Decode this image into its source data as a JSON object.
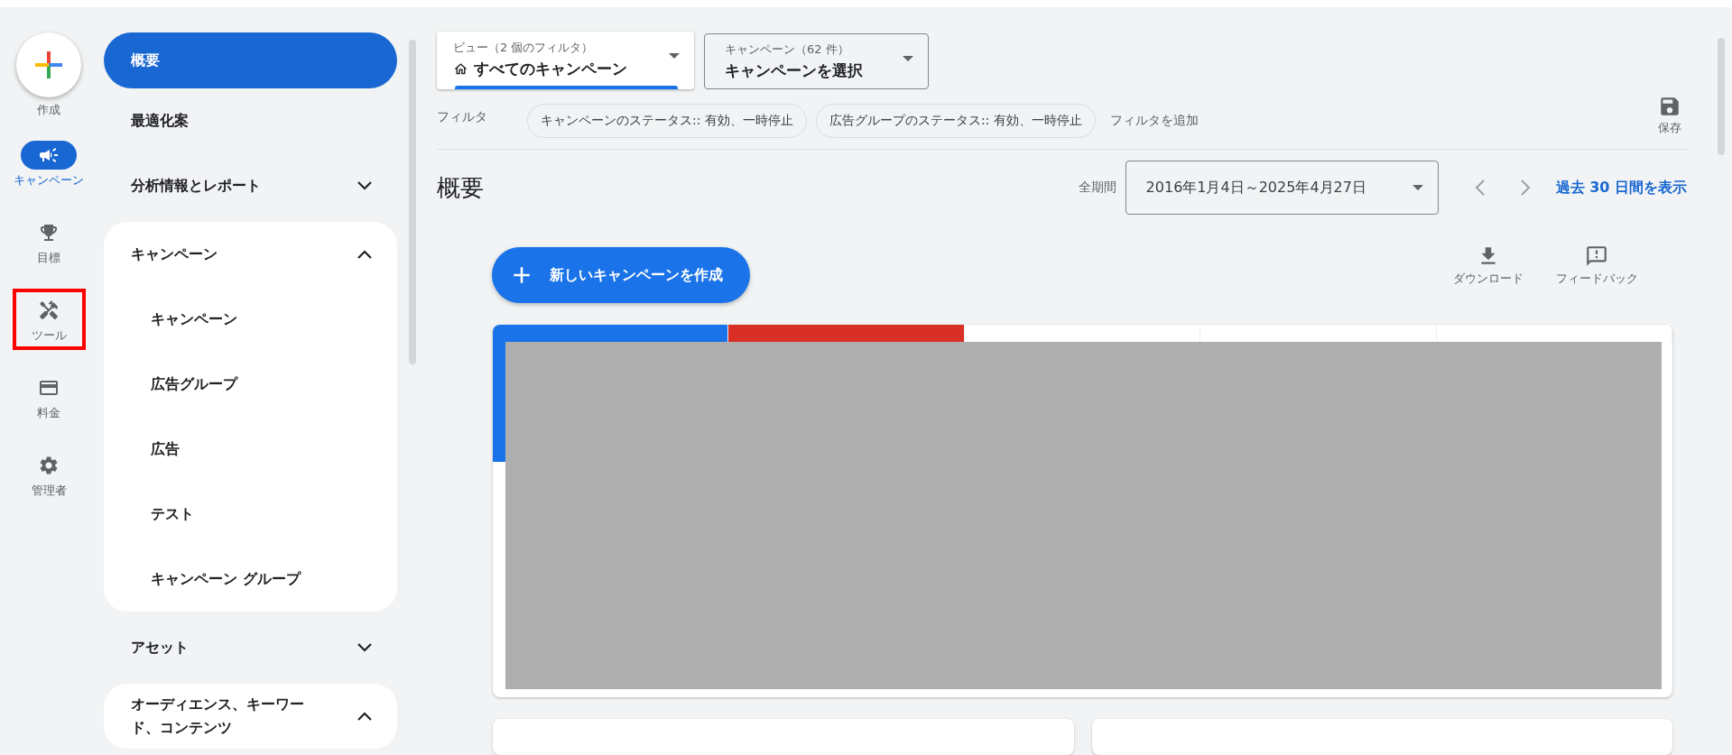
{
  "rail": {
    "create": {
      "label": "作成"
    },
    "items": [
      {
        "kind": "campaign",
        "label": "キャンペーン",
        "selected": true,
        "highlighted": false
      },
      {
        "kind": "goals",
        "label": "目標",
        "selected": false,
        "highlighted": false
      },
      {
        "kind": "tools",
        "label": "ツール",
        "selected": false,
        "highlighted": true
      },
      {
        "kind": "billing",
        "label": "料金",
        "selected": false,
        "highlighted": false
      },
      {
        "kind": "admin",
        "label": "管理者",
        "selected": false,
        "highlighted": false
      }
    ]
  },
  "nav": {
    "items": [
      {
        "label": "概要",
        "selected": true
      },
      {
        "label": "最適化案",
        "selected": false
      },
      {
        "label": "分析情報とレポート",
        "selected": false,
        "expanded": false
      },
      {
        "label": "キャンペーン",
        "selected": false,
        "expanded": true,
        "children": [
          {
            "label": "キャンペーン",
            "selected": false
          },
          {
            "label": "広告グループ",
            "selected": false
          },
          {
            "label": "広告",
            "selected": false
          },
          {
            "label": "テスト",
            "selected": false
          },
          {
            "label": "キャンペーン グループ",
            "selected": false
          }
        ]
      },
      {
        "label": "アセット",
        "selected": false,
        "expanded": false
      },
      {
        "label": "オーディエンス、キーワード、コンテンツ",
        "selected": false,
        "expanded": true
      }
    ]
  },
  "view_picker": {
    "label": "ビュー（2 個のフィルタ）",
    "value": "すべてのキャンペーン"
  },
  "campaign_picker": {
    "label": "キャンペーン（62 件）",
    "value": "キャンペーンを選択"
  },
  "filters": {
    "label": "フィルタ",
    "chips": [
      "キャンペーンのステータス:: 有効、一時停止",
      "広告グループのステータス:: 有効、一時停止"
    ],
    "add": "フィルタを追加"
  },
  "save": {
    "label": "保存"
  },
  "page_title": "概要",
  "date_range": {
    "label": "全期間",
    "value": "2016年1月4日～2025年4月27日",
    "link": "過去 30 日間を表示"
  },
  "new_campaign_button": "新しいキャンペーンを作成",
  "actions": [
    {
      "kind": "download",
      "label": "ダウンロード"
    },
    {
      "kind": "feedback",
      "label": "フィードバック"
    }
  ],
  "metric_tabs": [
    {
      "color": "#1a73e8"
    },
    {
      "color": "#d93025"
    },
    {
      "color": "#ffffff"
    },
    {
      "color": "#ffffff"
    },
    {
      "color": "#ffffff"
    }
  ]
}
